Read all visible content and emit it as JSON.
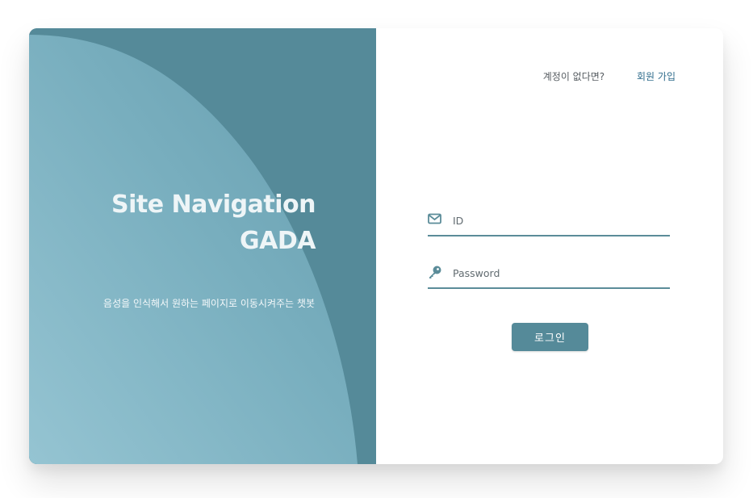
{
  "brand": {
    "title_line1": "Site Navigation",
    "title_line2": "GADA",
    "tagline": "음성을 인식해서 원하는 페이지로 이동시켜주는 챗봇"
  },
  "signup": {
    "question": "계정이 없다면?",
    "link_label": "회원 가입"
  },
  "form": {
    "id_placeholder": "ID",
    "id_value": "",
    "password_placeholder": "Password",
    "password_value": "",
    "id_icon": "envelope-icon",
    "password_icon": "key-icon",
    "submit_label": "로그인"
  },
  "colors": {
    "accent": "#558a99",
    "accent_light": "#95c4d2",
    "link": "#2f6c8c",
    "background": "#ffffff"
  }
}
